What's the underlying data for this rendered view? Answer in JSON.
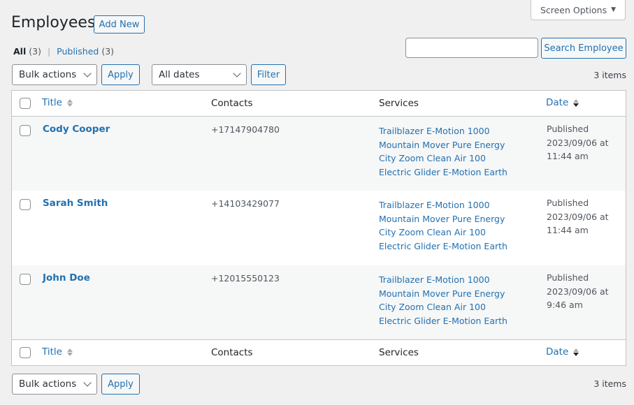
{
  "screen_options": {
    "label": "Screen Options"
  },
  "header": {
    "title": "Employees",
    "add_new_label": "Add New"
  },
  "views": {
    "all": {
      "label": "All",
      "count": "(3)"
    },
    "separator": "|",
    "published": {
      "label": "Published",
      "count": "(3)"
    }
  },
  "search": {
    "placeholder": "",
    "value": "",
    "button_label": "Search Employee"
  },
  "top_nav": {
    "bulk_actions": "Bulk actions",
    "apply_label": "Apply",
    "dates_filter": "All dates",
    "filter_label": "Filter",
    "items_count": "3 items"
  },
  "bottom_nav": {
    "bulk_actions": "Bulk actions",
    "apply_label": "Apply",
    "items_count": "3 items"
  },
  "table": {
    "columns": {
      "title": "Title",
      "contacts": "Contacts",
      "services": "Services",
      "date": "Date"
    },
    "rows": [
      {
        "title": "Cody Cooper",
        "contact": "+17147904780",
        "services": [
          "Trailblazer E-Motion 1000",
          "Mountain Mover Pure Energy",
          "City Zoom Clean Air 100",
          "Electric Glider E-Motion Earth"
        ],
        "status": "Published",
        "date_line": "2023/09/06 at",
        "time": "11:44 am"
      },
      {
        "title": "Sarah Smith",
        "contact": "+14103429077",
        "services": [
          "Trailblazer E-Motion 1000",
          "Mountain Mover Pure Energy",
          "City Zoom Clean Air 100",
          "Electric Glider E-Motion Earth"
        ],
        "status": "Published",
        "date_line": "2023/09/06 at",
        "time": "11:44 am"
      },
      {
        "title": "John Doe",
        "contact": "+12015550123",
        "services": [
          "Trailblazer E-Motion 1000",
          "Mountain Mover Pure Energy",
          "City Zoom Clean Air 100",
          "Electric Glider E-Motion Earth"
        ],
        "status": "Published",
        "date_line": "2023/09/06 at",
        "time": "9:46 am"
      }
    ]
  },
  "colors": {
    "accent": "#2271b1",
    "background": "#f0f0f1",
    "alt_row": "#f6f7f7"
  }
}
